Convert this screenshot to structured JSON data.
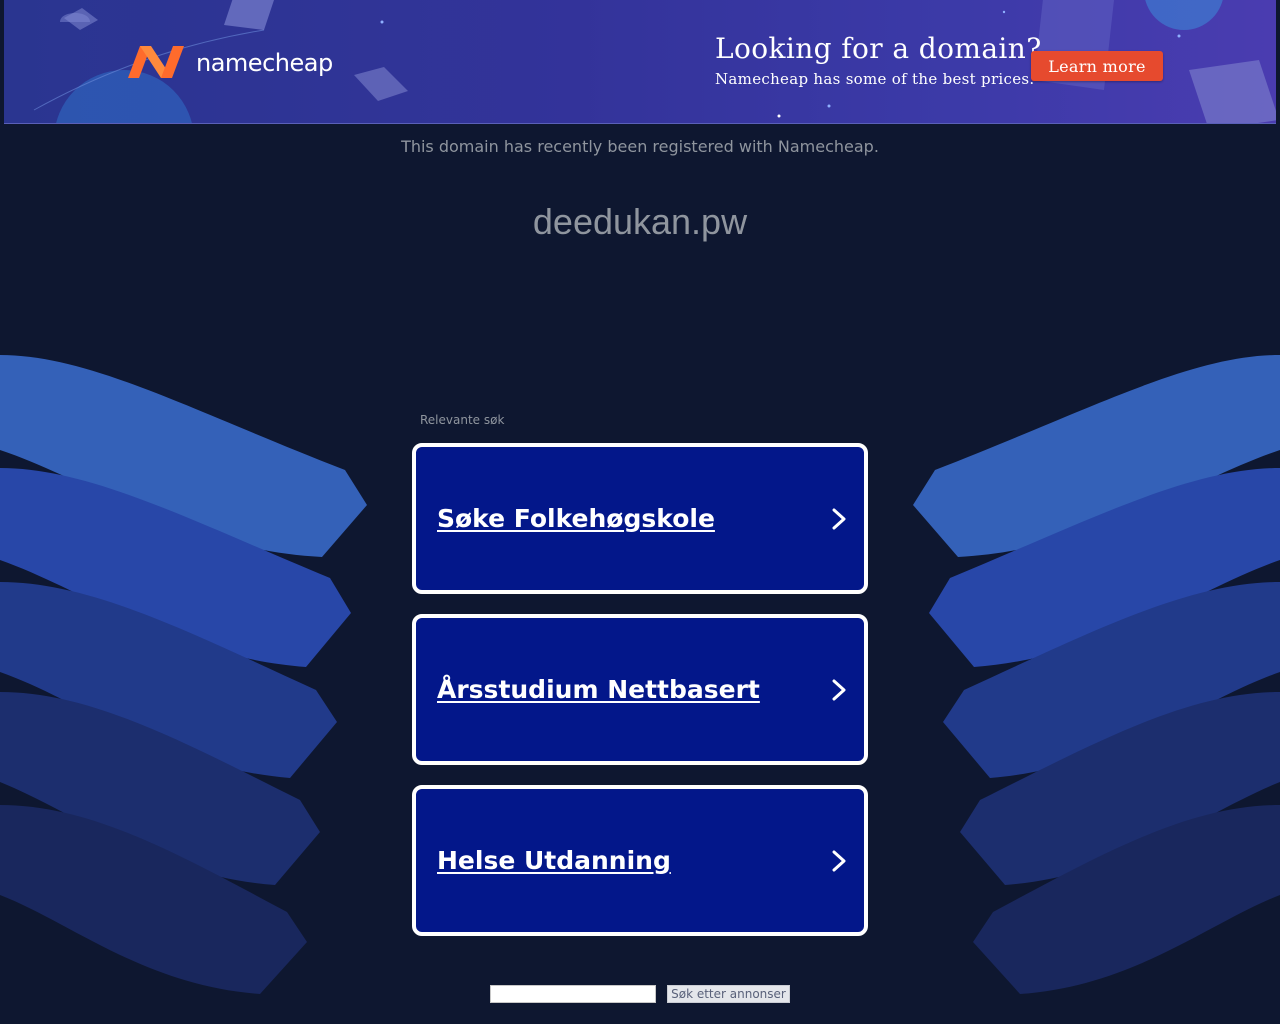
{
  "banner": {
    "brand_name": "namecheap",
    "logo_icon": "namecheap-n-logo-icon",
    "promo_title": "Looking for a domain?",
    "promo_subtitle": "Namecheap has some of the best prices.",
    "learn_more_label": "Learn more",
    "colors": {
      "accent": "#e64a2e",
      "logo_orange": "#ff6b2c",
      "banner_bg": "#33339a"
    }
  },
  "registered_notice": "This domain has recently been registered with Namecheap.",
  "domain_name": "deedukan.pw",
  "related": {
    "label": "Relevante søk",
    "items": [
      {
        "label": "Søke Folkehøgskole",
        "icon": "chevron-right-icon"
      },
      {
        "label": "Årsstudium Nettbasert",
        "icon": "chevron-right-icon"
      },
      {
        "label": "Helse Utdanning",
        "icon": "chevron-right-icon"
      }
    ]
  },
  "search": {
    "input_value": "",
    "button_label": "Søk etter annonser"
  },
  "colors": {
    "page_bg": "#0e1730",
    "card_bg": "#03178a",
    "muted_text": "#8f959e"
  }
}
